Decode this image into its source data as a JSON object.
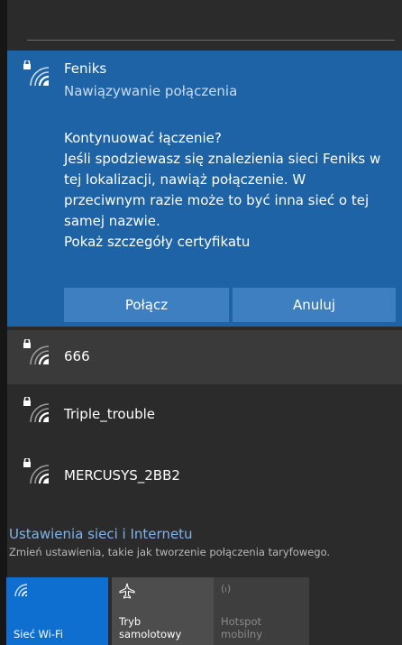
{
  "connecting_network": {
    "name": "Feniks",
    "status": "Nawiązywanie połączenia",
    "prompt_lines": [
      "Kontynuować łączenie?",
      "Jeśli spodziewasz się znalezienia sieci Feniks w",
      "tej lokalizacji, nawiąż połączenie. W",
      "przeciwnym razie może to być inna sieć o tej",
      "samej nazwie.",
      "Pokaż szczegóły certyfikatu"
    ],
    "connect_label": "Połącz",
    "cancel_label": "Anuluj"
  },
  "networks": [
    {
      "name": "666"
    },
    {
      "name": "Triple_trouble"
    },
    {
      "name": "MERCUSYS_2BB2"
    }
  ],
  "settings": {
    "title": "Ustawienia sieci i Internetu",
    "subtitle": "Zmień ustawienia, takie jak tworzenie połączenia taryfowego."
  },
  "quick_actions": [
    {
      "label": "Sieć Wi-Fi",
      "icon": "wifi-icon"
    },
    {
      "label_lines": [
        "Tryb",
        "samolotowy"
      ],
      "icon": "airplane-icon"
    },
    {
      "label_lines": [
        "Hotspot",
        "mobilny"
      ],
      "icon": "hotspot-icon"
    }
  ],
  "colors": {
    "card": "#1e63a6",
    "button": "#3d7fc0",
    "accent_tile": "#0f6fd1",
    "link": "#7fb2ea"
  }
}
